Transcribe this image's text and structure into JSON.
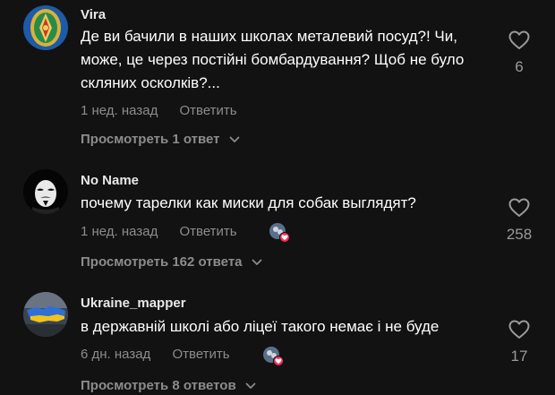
{
  "comments": [
    {
      "username": "Vira",
      "text": "Де ви бачили в наших школах металевий посуд?! Чи, може, це через постійні бомбардування? Щоб не було скляних осколків?...",
      "time": "1 нед. назад",
      "reply_label": "Ответить",
      "likes": "6",
      "view_replies": "Просмотреть 1 ответ",
      "avatar_icon": "ornament-avatar"
    },
    {
      "username": "No Name",
      "text": "почему тарелки как миски для собак выглядят?",
      "time": "1 нед. назад",
      "reply_label": "Ответить",
      "likes": "258",
      "view_replies": "Просмотреть 162 ответа",
      "avatar_icon": "mask-avatar"
    },
    {
      "username": "Ukraine_mapper",
      "text": "в державній школі або ліцеї такого немає і не буде",
      "time": "6 дн. назад",
      "reply_label": "Ответить",
      "likes": "17",
      "view_replies": "Просмотреть 8 ответов",
      "avatar_icon": "map-avatar"
    }
  ],
  "colors": {
    "background": "#121212",
    "text": "#ffffff",
    "muted": "#8c8c8c",
    "heart_badge": "#fe2c55"
  }
}
